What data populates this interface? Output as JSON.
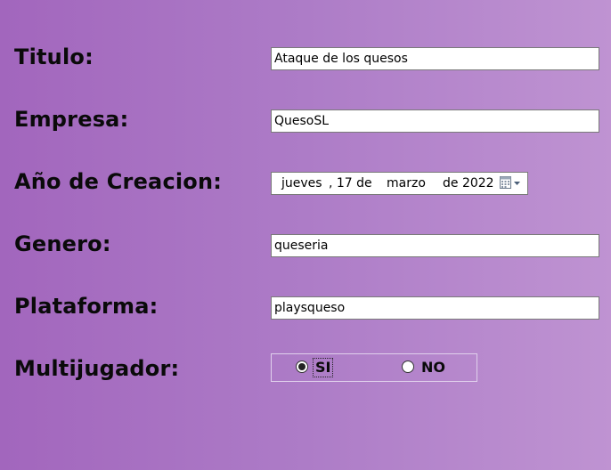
{
  "form": {
    "titulo": {
      "label": "Titulo:",
      "value": "Ataque de los quesos"
    },
    "empresa": {
      "label": "Empresa:",
      "value": "QuesoSL"
    },
    "anio": {
      "label": "Año de Creacion:",
      "weekday": "jueves",
      "day_sep": ", 17 de",
      "month": "marzo",
      "year_sep": "de 2022",
      "icon": "calendar-icon"
    },
    "genero": {
      "label": "Genero:",
      "value": "queseria"
    },
    "plataforma": {
      "label": "Plataforma:",
      "value": "playsqueso"
    },
    "multijugador": {
      "label": "Multijugador:",
      "options": [
        {
          "label": "SI",
          "checked": true
        },
        {
          "label": "NO",
          "checked": false
        }
      ]
    }
  },
  "colors": {
    "background_start": "#a266bd",
    "background_end": "#bf93d2"
  }
}
